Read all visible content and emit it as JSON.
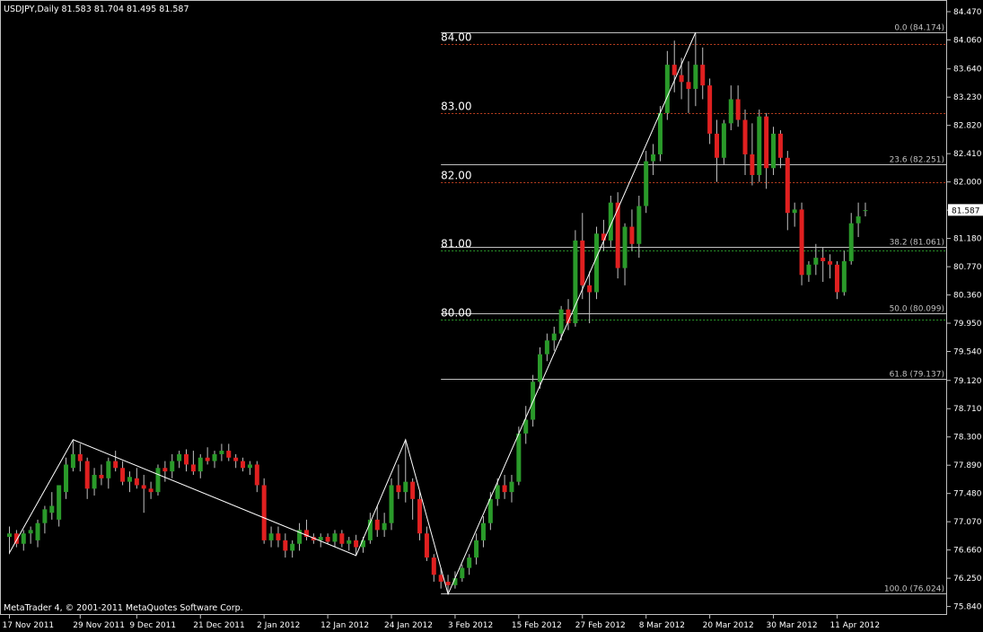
{
  "window": {
    "title": "USDJPY,Daily  81.583 81.704 81.495 81.587",
    "copyright": "MetaTrader 4, © 2001-2011 MetaQuotes Software Corp."
  },
  "colors": {
    "background": "#000000",
    "axis": "#c0c0c0",
    "bull": "#2a9a2a",
    "bear": "#e02020",
    "wick": "#c0c0c0",
    "zigzag": "#ffffff",
    "fib": "#c0c0c0",
    "resistance": "#c04020",
    "support": "#2a9a2a"
  },
  "chart_data": {
    "type": "candlestick",
    "symbol": "USDJPY",
    "timeframe": "Daily",
    "current_price": "81.587",
    "ylim": [
      75.9,
      84.47
    ],
    "y_ticks": [
      "84.470",
      "84.060",
      "83.640",
      "83.230",
      "82.820",
      "82.410",
      "82.000",
      "81.590",
      "81.180",
      "80.770",
      "80.360",
      "79.950",
      "79.540",
      "79.120",
      "78.710",
      "78.300",
      "77.890",
      "77.480",
      "77.070",
      "76.660",
      "76.250",
      "75.840"
    ],
    "x_ticks": [
      "17 Nov 2011",
      "29 Nov 2011",
      "9 Dec 2011",
      "21 Dec 2011",
      "2 Jan 2012",
      "12 Jan 2012",
      "24 Jan 2012",
      "3 Feb 2012",
      "15 Feb 2012",
      "27 Feb 2012",
      "8 Mar 2012",
      "20 Mar 2012",
      "30 Mar 2012",
      "11 Apr 2012"
    ],
    "x_tick_index": [
      0,
      10,
      18,
      27,
      36,
      45,
      54,
      63,
      72,
      81,
      90,
      99,
      108,
      117
    ],
    "fibonacci": [
      {
        "label": "0.0 (84.174)",
        "price": 84.174
      },
      {
        "label": "23.6 (82.251)",
        "price": 82.251
      },
      {
        "label": "38.2 (81.061)",
        "price": 81.061
      },
      {
        "label": "50.0 (80.099)",
        "price": 80.099
      },
      {
        "label": "61.8 (79.137)",
        "price": 79.137
      },
      {
        "label": "100.0 (76.024)",
        "price": 76.024
      }
    ],
    "fib_start_index": 61,
    "levels": [
      {
        "label": "84.00",
        "price": 84.0,
        "kind": "resistance"
      },
      {
        "label": "83.00",
        "price": 83.0,
        "kind": "resistance"
      },
      {
        "label": "82.00",
        "price": 82.0,
        "kind": "resistance"
      },
      {
        "label": "81.00",
        "price": 81.0,
        "kind": "support"
      },
      {
        "label": "80.00",
        "price": 80.0,
        "kind": "support"
      }
    ],
    "zigzag": [
      {
        "i": 0,
        "price": 76.62
      },
      {
        "i": 9,
        "price": 78.26
      },
      {
        "i": 49,
        "price": 76.58
      },
      {
        "i": 56,
        "price": 78.26
      },
      {
        "i": 62,
        "price": 76.02
      },
      {
        "i": 97,
        "price": 84.17
      }
    ],
    "candles": [
      {
        "o": 76.85,
        "h": 77.0,
        "l": 76.6,
        "c": 76.9
      },
      {
        "o": 76.9,
        "h": 76.95,
        "l": 76.7,
        "c": 76.75
      },
      {
        "o": 76.75,
        "h": 76.95,
        "l": 76.65,
        "c": 76.9
      },
      {
        "o": 76.9,
        "h": 77.0,
        "l": 76.75,
        "c": 76.95
      },
      {
        "o": 76.8,
        "h": 77.1,
        "l": 76.7,
        "c": 77.05
      },
      {
        "o": 77.05,
        "h": 77.3,
        "l": 76.9,
        "c": 77.25
      },
      {
        "o": 77.2,
        "h": 77.5,
        "l": 77.1,
        "c": 77.3
      },
      {
        "o": 77.1,
        "h": 77.6,
        "l": 77.0,
        "c": 77.6
      },
      {
        "o": 77.5,
        "h": 78.0,
        "l": 77.4,
        "c": 77.9
      },
      {
        "o": 77.85,
        "h": 78.26,
        "l": 77.8,
        "c": 78.05
      },
      {
        "o": 78.05,
        "h": 78.2,
        "l": 77.8,
        "c": 77.95
      },
      {
        "o": 77.95,
        "h": 78.0,
        "l": 77.4,
        "c": 77.55
      },
      {
        "o": 77.55,
        "h": 77.85,
        "l": 77.45,
        "c": 77.75
      },
      {
        "o": 77.75,
        "h": 77.9,
        "l": 77.6,
        "c": 77.7
      },
      {
        "o": 77.7,
        "h": 78.0,
        "l": 77.55,
        "c": 77.95
      },
      {
        "o": 77.95,
        "h": 78.1,
        "l": 77.8,
        "c": 77.85
      },
      {
        "o": 77.85,
        "h": 77.95,
        "l": 77.6,
        "c": 77.65
      },
      {
        "o": 77.65,
        "h": 77.8,
        "l": 77.5,
        "c": 77.72
      },
      {
        "o": 77.7,
        "h": 77.85,
        "l": 77.55,
        "c": 77.6
      },
      {
        "o": 77.6,
        "h": 77.75,
        "l": 77.2,
        "c": 77.55
      },
      {
        "o": 77.55,
        "h": 77.65,
        "l": 77.4,
        "c": 77.5
      },
      {
        "o": 77.5,
        "h": 77.9,
        "l": 77.45,
        "c": 77.85
      },
      {
        "o": 77.85,
        "h": 77.95,
        "l": 77.65,
        "c": 77.8
      },
      {
        "o": 77.8,
        "h": 78.05,
        "l": 77.7,
        "c": 77.95
      },
      {
        "o": 77.95,
        "h": 78.1,
        "l": 77.85,
        "c": 78.05
      },
      {
        "o": 78.05,
        "h": 78.12,
        "l": 77.8,
        "c": 77.9
      },
      {
        "o": 77.9,
        "h": 78.1,
        "l": 77.75,
        "c": 77.8
      },
      {
        "o": 77.8,
        "h": 78.05,
        "l": 77.7,
        "c": 78.0
      },
      {
        "o": 78.0,
        "h": 78.15,
        "l": 77.9,
        "c": 77.95
      },
      {
        "o": 77.95,
        "h": 78.1,
        "l": 77.85,
        "c": 78.05
      },
      {
        "o": 78.05,
        "h": 78.2,
        "l": 77.95,
        "c": 78.1
      },
      {
        "o": 78.1,
        "h": 78.2,
        "l": 77.95,
        "c": 78.0
      },
      {
        "o": 78.0,
        "h": 78.05,
        "l": 77.85,
        "c": 77.95
      },
      {
        "o": 77.95,
        "h": 78.0,
        "l": 77.8,
        "c": 77.85
      },
      {
        "o": 77.85,
        "h": 77.95,
        "l": 77.75,
        "c": 77.9
      },
      {
        "o": 77.9,
        "h": 77.95,
        "l": 77.5,
        "c": 77.6
      },
      {
        "o": 77.6,
        "h": 77.7,
        "l": 76.75,
        "c": 76.8
      },
      {
        "o": 76.8,
        "h": 77.0,
        "l": 76.7,
        "c": 76.9
      },
      {
        "o": 76.9,
        "h": 77.0,
        "l": 76.7,
        "c": 76.8
      },
      {
        "o": 76.8,
        "h": 76.9,
        "l": 76.55,
        "c": 76.65
      },
      {
        "o": 76.65,
        "h": 76.8,
        "l": 76.55,
        "c": 76.75
      },
      {
        "o": 76.75,
        "h": 77.05,
        "l": 76.65,
        "c": 76.95
      },
      {
        "o": 76.95,
        "h": 77.1,
        "l": 76.8,
        "c": 76.85
      },
      {
        "o": 76.85,
        "h": 76.9,
        "l": 76.75,
        "c": 76.8
      },
      {
        "o": 76.8,
        "h": 76.9,
        "l": 76.7,
        "c": 76.85
      },
      {
        "o": 76.85,
        "h": 76.9,
        "l": 76.75,
        "c": 76.78
      },
      {
        "o": 76.78,
        "h": 76.95,
        "l": 76.7,
        "c": 76.9
      },
      {
        "o": 76.9,
        "h": 76.95,
        "l": 76.7,
        "c": 76.75
      },
      {
        "o": 76.75,
        "h": 76.85,
        "l": 76.65,
        "c": 76.8
      },
      {
        "o": 76.8,
        "h": 76.88,
        "l": 76.58,
        "c": 76.7
      },
      {
        "o": 76.7,
        "h": 76.85,
        "l": 76.62,
        "c": 76.8
      },
      {
        "o": 76.8,
        "h": 77.2,
        "l": 76.75,
        "c": 77.1
      },
      {
        "o": 77.1,
        "h": 77.3,
        "l": 76.85,
        "c": 76.95
      },
      {
        "o": 76.95,
        "h": 77.2,
        "l": 76.85,
        "c": 77.05
      },
      {
        "o": 77.05,
        "h": 77.7,
        "l": 76.95,
        "c": 77.6
      },
      {
        "o": 77.6,
        "h": 77.9,
        "l": 77.4,
        "c": 77.5
      },
      {
        "o": 77.5,
        "h": 78.26,
        "l": 77.35,
        "c": 77.65
      },
      {
        "o": 77.65,
        "h": 77.7,
        "l": 77.1,
        "c": 77.4
      },
      {
        "o": 77.4,
        "h": 77.5,
        "l": 76.8,
        "c": 76.9
      },
      {
        "o": 76.9,
        "h": 77.0,
        "l": 76.5,
        "c": 76.55
      },
      {
        "o": 76.55,
        "h": 76.6,
        "l": 76.2,
        "c": 76.3
      },
      {
        "o": 76.3,
        "h": 76.4,
        "l": 76.1,
        "c": 76.2
      },
      {
        "o": 76.2,
        "h": 76.3,
        "l": 76.02,
        "c": 76.15
      },
      {
        "o": 76.15,
        "h": 76.35,
        "l": 76.1,
        "c": 76.25
      },
      {
        "o": 76.25,
        "h": 76.45,
        "l": 76.2,
        "c": 76.4
      },
      {
        "o": 76.4,
        "h": 76.6,
        "l": 76.3,
        "c": 76.55
      },
      {
        "o": 76.55,
        "h": 76.9,
        "l": 76.45,
        "c": 76.8
      },
      {
        "o": 76.8,
        "h": 77.15,
        "l": 76.7,
        "c": 77.05
      },
      {
        "o": 77.05,
        "h": 77.5,
        "l": 76.95,
        "c": 77.4
      },
      {
        "o": 77.4,
        "h": 77.7,
        "l": 77.3,
        "c": 77.6
      },
      {
        "o": 77.6,
        "h": 77.75,
        "l": 77.4,
        "c": 77.5
      },
      {
        "o": 77.5,
        "h": 77.75,
        "l": 77.35,
        "c": 77.65
      },
      {
        "o": 77.65,
        "h": 78.45,
        "l": 77.6,
        "c": 78.35
      },
      {
        "o": 78.35,
        "h": 78.75,
        "l": 78.2,
        "c": 78.55
      },
      {
        "o": 78.55,
        "h": 79.2,
        "l": 78.45,
        "c": 79.1
      },
      {
        "o": 79.1,
        "h": 79.6,
        "l": 79.0,
        "c": 79.5
      },
      {
        "o": 79.5,
        "h": 79.8,
        "l": 79.4,
        "c": 79.7
      },
      {
        "o": 79.7,
        "h": 79.9,
        "l": 79.55,
        "c": 79.8
      },
      {
        "o": 79.8,
        "h": 80.2,
        "l": 79.7,
        "c": 80.15
      },
      {
        "o": 80.15,
        "h": 80.3,
        "l": 79.85,
        "c": 79.95
      },
      {
        "o": 79.95,
        "h": 81.3,
        "l": 79.9,
        "c": 81.15
      },
      {
        "o": 81.15,
        "h": 81.55,
        "l": 80.3,
        "c": 80.5
      },
      {
        "o": 80.5,
        "h": 80.7,
        "l": 79.95,
        "c": 80.4
      },
      {
        "o": 80.4,
        "h": 81.35,
        "l": 80.3,
        "c": 81.25
      },
      {
        "o": 81.25,
        "h": 81.45,
        "l": 81.0,
        "c": 81.15
      },
      {
        "o": 81.15,
        "h": 81.8,
        "l": 81.05,
        "c": 81.7
      },
      {
        "o": 81.7,
        "h": 81.85,
        "l": 80.6,
        "c": 80.75
      },
      {
        "o": 80.75,
        "h": 81.4,
        "l": 80.5,
        "c": 81.35
      },
      {
        "o": 81.35,
        "h": 81.6,
        "l": 81.0,
        "c": 81.1
      },
      {
        "o": 81.1,
        "h": 81.8,
        "l": 80.9,
        "c": 81.65
      },
      {
        "o": 81.65,
        "h": 82.45,
        "l": 81.55,
        "c": 82.3
      },
      {
        "o": 82.3,
        "h": 82.55,
        "l": 82.1,
        "c": 82.4
      },
      {
        "o": 82.4,
        "h": 83.1,
        "l": 82.3,
        "c": 83.0
      },
      {
        "o": 83.0,
        "h": 83.9,
        "l": 82.9,
        "c": 83.7
      },
      {
        "o": 83.7,
        "h": 84.05,
        "l": 83.3,
        "c": 83.55
      },
      {
        "o": 83.55,
        "h": 83.8,
        "l": 83.2,
        "c": 83.45
      },
      {
        "o": 83.45,
        "h": 83.75,
        "l": 83.0,
        "c": 83.35
      },
      {
        "o": 83.35,
        "h": 84.17,
        "l": 83.1,
        "c": 83.7
      },
      {
        "o": 83.7,
        "h": 83.95,
        "l": 83.2,
        "c": 83.4
      },
      {
        "o": 83.4,
        "h": 83.5,
        "l": 82.55,
        "c": 82.7
      },
      {
        "o": 82.7,
        "h": 82.9,
        "l": 82.0,
        "c": 82.35
      },
      {
        "o": 82.35,
        "h": 82.9,
        "l": 82.25,
        "c": 82.85
      },
      {
        "o": 82.85,
        "h": 83.4,
        "l": 82.75,
        "c": 83.2
      },
      {
        "o": 83.2,
        "h": 83.4,
        "l": 82.8,
        "c": 82.9
      },
      {
        "o": 82.9,
        "h": 83.05,
        "l": 82.1,
        "c": 82.4
      },
      {
        "o": 82.4,
        "h": 82.85,
        "l": 81.95,
        "c": 82.1
      },
      {
        "o": 82.1,
        "h": 83.05,
        "l": 82.0,
        "c": 82.95
      },
      {
        "o": 82.95,
        "h": 83.0,
        "l": 81.9,
        "c": 82.2
      },
      {
        "o": 82.2,
        "h": 82.8,
        "l": 82.1,
        "c": 82.7
      },
      {
        "o": 82.7,
        "h": 82.75,
        "l": 82.2,
        "c": 82.35
      },
      {
        "o": 82.35,
        "h": 82.45,
        "l": 81.3,
        "c": 81.55
      },
      {
        "o": 81.55,
        "h": 81.7,
        "l": 81.35,
        "c": 81.6
      },
      {
        "o": 81.6,
        "h": 81.7,
        "l": 80.5,
        "c": 80.65
      },
      {
        "o": 80.65,
        "h": 80.85,
        "l": 80.55,
        "c": 80.8
      },
      {
        "o": 80.8,
        "h": 81.1,
        "l": 80.65,
        "c": 80.9
      },
      {
        "o": 80.9,
        "h": 81.05,
        "l": 80.55,
        "c": 80.85
      },
      {
        "o": 80.85,
        "h": 80.95,
        "l": 80.6,
        "c": 80.8
      },
      {
        "o": 80.8,
        "h": 80.85,
        "l": 80.3,
        "c": 80.4
      },
      {
        "o": 80.4,
        "h": 81.0,
        "l": 80.35,
        "c": 80.85
      },
      {
        "o": 80.85,
        "h": 81.55,
        "l": 80.8,
        "c": 81.4
      },
      {
        "o": 81.4,
        "h": 81.7,
        "l": 81.2,
        "c": 81.5
      },
      {
        "o": 81.58,
        "h": 81.7,
        "l": 81.5,
        "c": 81.59
      }
    ]
  }
}
